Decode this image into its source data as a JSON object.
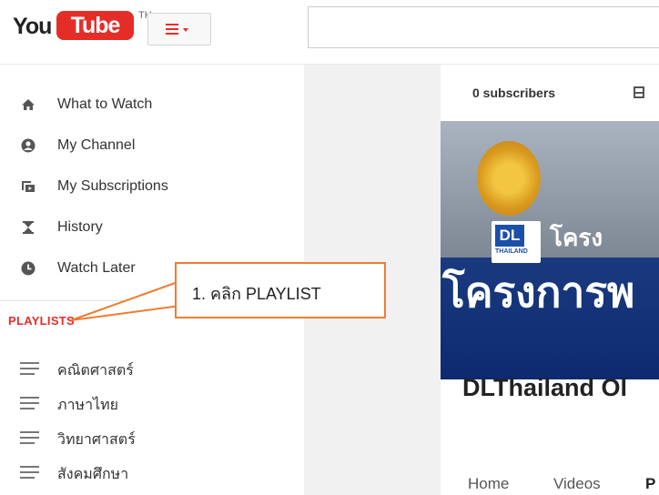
{
  "header": {
    "logo_you": "You",
    "logo_tube": "Tube",
    "logo_region": "TH",
    "guide_icon": "hamburger-menu-icon"
  },
  "sidebar": {
    "items": [
      {
        "label": "What to Watch",
        "icon": "home-icon"
      },
      {
        "label": "My Channel",
        "icon": "user-circle-icon"
      },
      {
        "label": "My Subscriptions",
        "icon": "subscriptions-icon"
      },
      {
        "label": "History",
        "icon": "hourglass-icon"
      },
      {
        "label": "Watch Later",
        "icon": "clock-icon"
      }
    ],
    "playlists_heading": "PLAYLISTS",
    "playlists": [
      {
        "label": "คณิตศาสตร์",
        "icon": "playlist-icon"
      },
      {
        "label": "ภาษาไทย",
        "icon": "playlist-icon"
      },
      {
        "label": "วิทยาศาสตร์",
        "icon": "playlist-icon"
      },
      {
        "label": "สังคมศึกษา",
        "icon": "playlist-icon"
      }
    ]
  },
  "channel": {
    "subscribers": "0 subscribers",
    "banner_text_small": "โครง",
    "banner_text_big": "โครงการพ",
    "banner_badge": "DL",
    "banner_badge_sub": "THAILAND",
    "title": "DLThailand Ol",
    "tabs": [
      "Home",
      "Videos",
      "P"
    ]
  },
  "callout": {
    "text": "1. คลิก PLAYLIST",
    "color": "#ed7d31"
  },
  "colors": {
    "brand_red": "#e52d27",
    "annotation_orange": "#ed7d31"
  }
}
